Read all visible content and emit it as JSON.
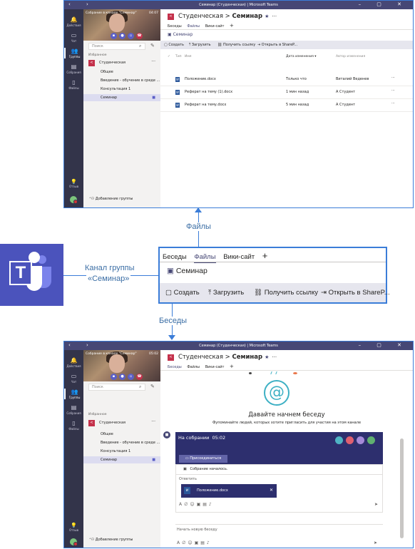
{
  "window_title": "Семинар (Студенческая) | Microsoft Teams",
  "rail": {
    "items": [
      "Действия",
      "Чат",
      "Группы",
      "Собрания",
      "Файлы"
    ],
    "help": "Отзыв"
  },
  "call": {
    "title": "Собрание в канале \"Семинар\"",
    "time_top": "04:07",
    "time_bottom": "05:02"
  },
  "sidebar": {
    "search_placeholder": "Поиск",
    "favorites": "Избранное",
    "team_name": "Студенческая",
    "channels": [
      "Общее",
      "Введение - обучение в среде ...",
      "Консультация 1",
      "Семинар"
    ],
    "add_group": "Добавление группы"
  },
  "header": {
    "team": "Студенческая",
    "separator": ">",
    "channel": "Семинар"
  },
  "tabs": [
    "Беседы",
    "Файлы",
    "Вики-сайт"
  ],
  "channel_strip": "Семинар",
  "toolbar": [
    "Создать",
    "Загрузить",
    "Получить ссылку",
    "Открыть в ShareP..."
  ],
  "files_header": {
    "type": "Тип",
    "name": "Имя",
    "modified": "Дата изменения",
    "author": "Автор изменения"
  },
  "files": [
    {
      "name": "Положение.docx",
      "modified": "Только что",
      "author": "Виталий Веденев"
    },
    {
      "name": "Реферат на тему (1).docx",
      "modified": "1 мин назад",
      "author": "А Студент"
    },
    {
      "name": "Реферат на тему.docx",
      "modified": "5 мин назад",
      "author": "А Студент"
    }
  ],
  "annotations": {
    "files": "Файлы",
    "channel_line1": "Канал группы",
    "channel_line2": "«Семинар»",
    "chats": "Беседы"
  },
  "zoom": {
    "tabs": [
      "Беседы",
      "Файлы",
      "Вики-сайт"
    ],
    "channel": "Семинар",
    "toolbar": [
      "Создать",
      "Загрузить",
      "Получить ссылку",
      "Открыть в ShareP..."
    ]
  },
  "conversation": {
    "heading": "Давайте начнем беседу",
    "subheading": "Фупоминайте людей, которых хотите пригласить для участия на этом канале",
    "meeting_title": "На собрании",
    "join_button": "Присоединиться",
    "meeting_started": "Собрание началось.",
    "reply": "Ответить",
    "attachment": "Положение.docx",
    "new_chat": "Начать новую беседу"
  },
  "colors": {
    "accent": "#464775",
    "rail": "#33344a",
    "team": "#c4314b",
    "highlight": "#3b7dd8"
  }
}
